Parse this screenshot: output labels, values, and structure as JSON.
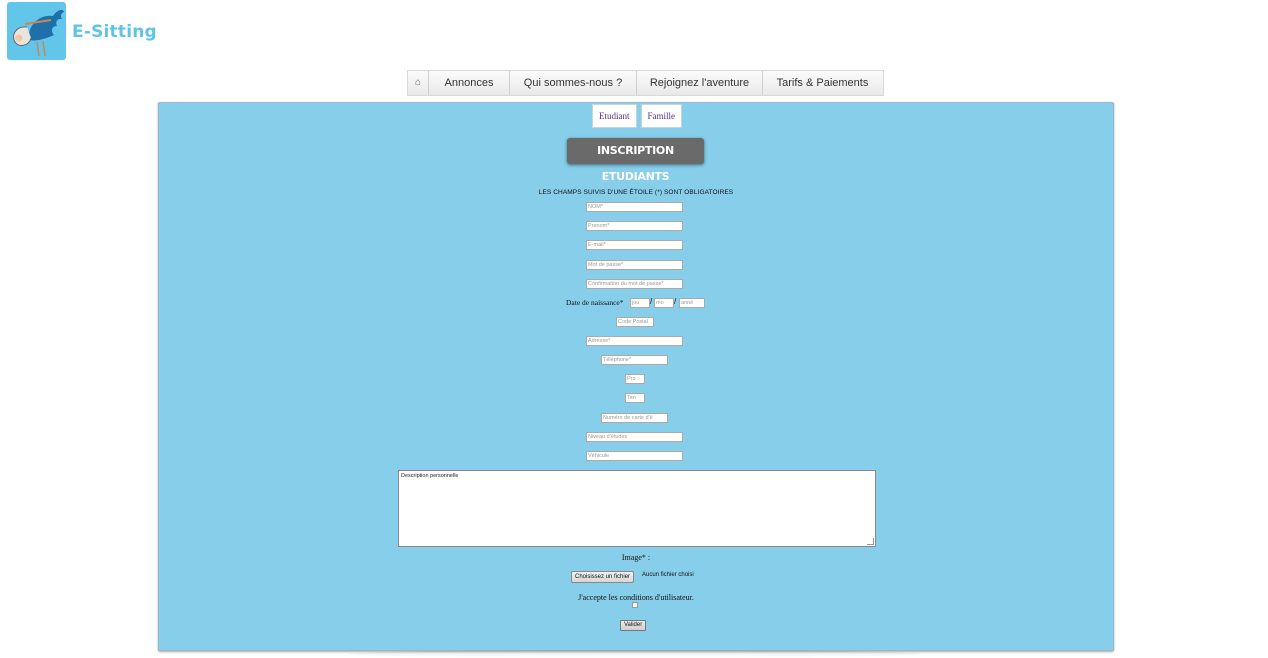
{
  "brand": {
    "name": "E-Sitting",
    "accent": "#5fc4e6"
  },
  "nav": {
    "home_icon": "home-icon",
    "items": [
      "Annonces",
      "Qui sommes-nous ?",
      "Rejoignez l'aventure",
      "Tarifs & Paiements"
    ]
  },
  "tabs": [
    "Etudiant",
    "Famille"
  ],
  "form": {
    "title": "INSCRIPTION ETUDIANTS",
    "required_note": "LES CHAMPS SUIVIS D'UNE ÉTOILE (*) SONT OBLIGATOIRES",
    "placeholders": {
      "nom": "NOM*",
      "prenom": "Prenom*",
      "email": "E-mail*",
      "password": "Mot de passe*",
      "password_confirm": "Confirmation du mot de passe*",
      "dob_day": "jou",
      "dob_month": "mo",
      "dob_year": "anné",
      "code_postal": "Code Postal",
      "adresse": "Adresse*",
      "telephone": "Téléphone*",
      "pro": "Pro",
      "ten": "Ten",
      "numero_carte": "Numéro de carte d'é",
      "niveau_etudes": "Niveau d'études",
      "vehicule": "Véhicule",
      "description": "Description personnelle"
    },
    "dob_label": "Date de naissance*",
    "dob_separator": "/",
    "image_label": "Image* :",
    "file_button": "Choisissez un fichier",
    "file_status": "Aucun fichier choisi",
    "terms_label": "J'accepte les conditions d'utilisateur.",
    "submit_label": "Valider"
  },
  "colors": {
    "panel_bg": "#87ceea",
    "title_bg": "#6a6a6a",
    "logo_bg": "#62c5ea"
  }
}
